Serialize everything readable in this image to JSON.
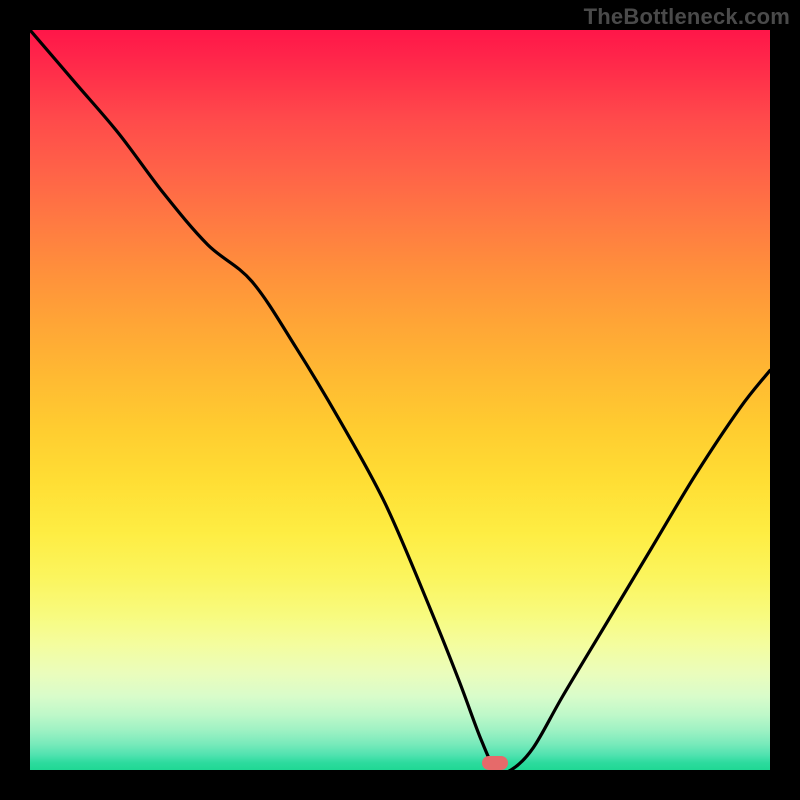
{
  "watermark": {
    "text": "TheBottleneck.com"
  },
  "marker": {
    "color": "#e66a6a",
    "left_pct": 62.8,
    "top_pct": 99.0
  },
  "chart_data": {
    "type": "line",
    "title": "",
    "xlabel": "",
    "ylabel": "",
    "xlim": [
      0,
      100
    ],
    "ylim": [
      0,
      100
    ],
    "background_gradient": {
      "orientation": "vertical",
      "top_color": "#ff1649",
      "bottom_color": "#1fd894",
      "meaning": "red=high bottleneck, green=balanced"
    },
    "annotations": [
      {
        "text": "TheBottleneck.com",
        "position": "top-right",
        "color": "#4a4a4a"
      }
    ],
    "marker": {
      "x": 62.8,
      "y": 0,
      "shape": "rounded-rect",
      "color": "#e66a6a"
    },
    "series": [
      {
        "name": "bottleneck-curve",
        "color": "#000000",
        "x": [
          0,
          6,
          12,
          18,
          24,
          30,
          36,
          42,
          48,
          54,
          58,
          61,
          63,
          65,
          68,
          72,
          78,
          84,
          90,
          96,
          100
        ],
        "y": [
          100,
          93,
          86,
          78,
          71,
          66,
          57,
          47,
          36,
          22,
          12,
          4,
          0,
          0,
          3,
          10,
          20,
          30,
          40,
          49,
          54
        ]
      }
    ]
  }
}
